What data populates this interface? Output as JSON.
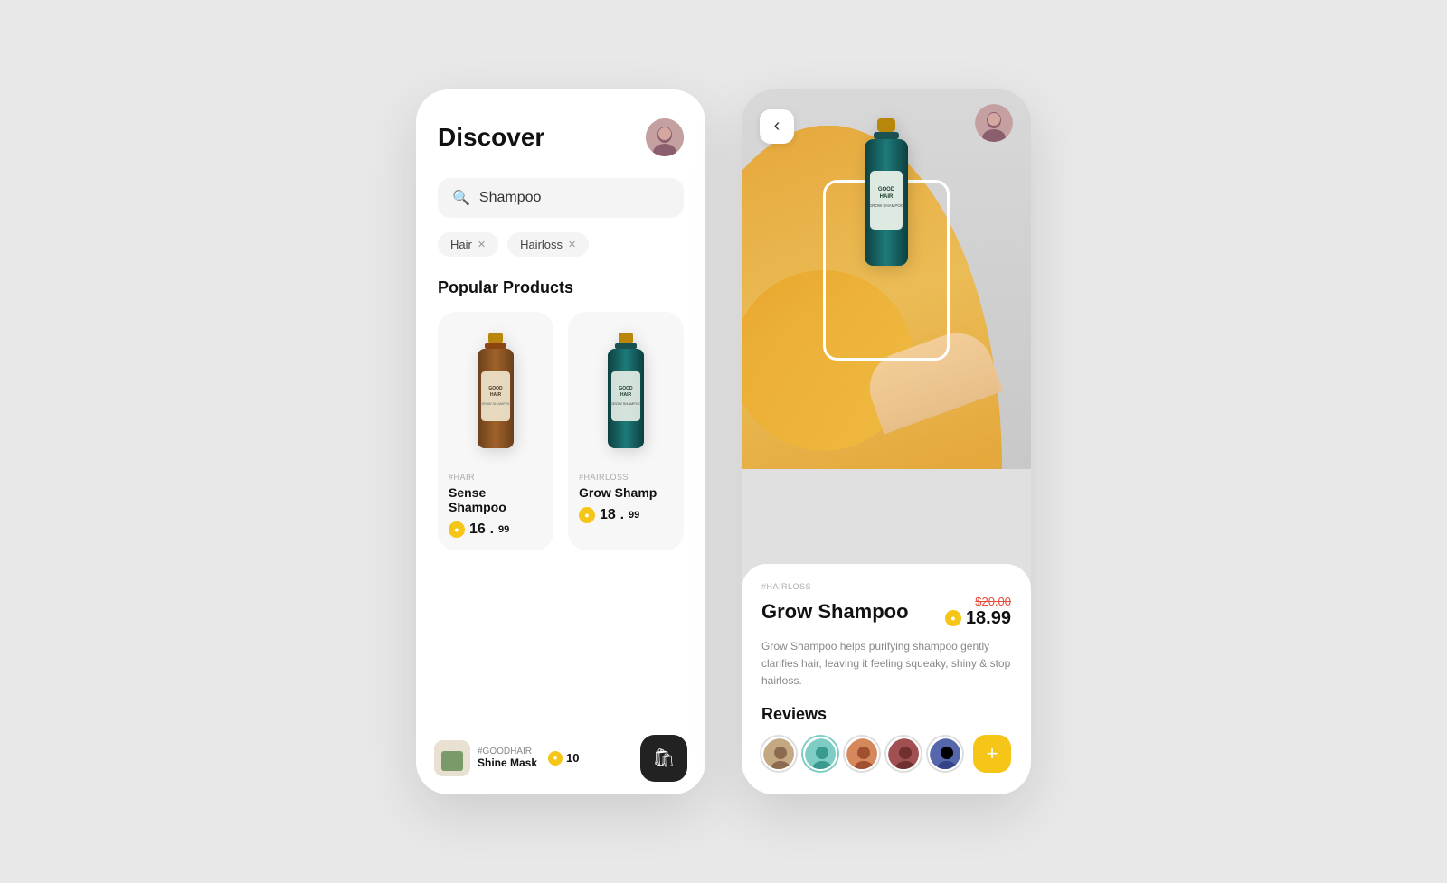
{
  "leftPhone": {
    "title": "Discover",
    "search": {
      "placeholder": "Shampoo",
      "value": "Shampoo"
    },
    "filters": [
      {
        "label": "Hair",
        "removable": true
      },
      {
        "label": "Hairloss",
        "removable": true
      }
    ],
    "sectionTitle": "Popular Products",
    "products": [
      {
        "tag": "#HAIR",
        "name": "Sense Shampoo",
        "priceInt": "16",
        "priceDec": "99",
        "bottleColor": "brown"
      },
      {
        "tag": "#HAIRLOSS",
        "name": "Grow Shamp",
        "priceInt": "18",
        "priceDec": "99",
        "bottleColor": "teal"
      }
    ],
    "bottomBar": {
      "miniTag": "#GOODHAIR",
      "miniName": "Shine Mask",
      "miniPrice": "10"
    },
    "cartIcon": "🛍"
  },
  "rightPhone": {
    "backIcon": "‹",
    "productTag": "#HAIRLOSS",
    "productName": "Grow Shampoo",
    "originalPrice": "$20.00",
    "currentPrice": "18.99",
    "description": "Grow Shampoo helps purifying shampoo gently clarifies hair, leaving it feeling squeaky, shiny & stop hairloss.",
    "reviewsTitle": "Reviews",
    "reviewers": [
      {
        "color": "#c4a882",
        "label": "reviewer-1"
      },
      {
        "color": "#7ecdc4",
        "label": "reviewer-2"
      },
      {
        "color": "#d4885c",
        "label": "reviewer-3"
      },
      {
        "color": "#a05050",
        "label": "reviewer-4"
      },
      {
        "color": "#5566aa",
        "label": "reviewer-5"
      }
    ],
    "addReviewIcon": "+"
  },
  "colors": {
    "accent": "#f5c518",
    "cartBg": "#222222",
    "tagColor": "#aaaaaa",
    "priceStrike": "#e74c3c"
  }
}
